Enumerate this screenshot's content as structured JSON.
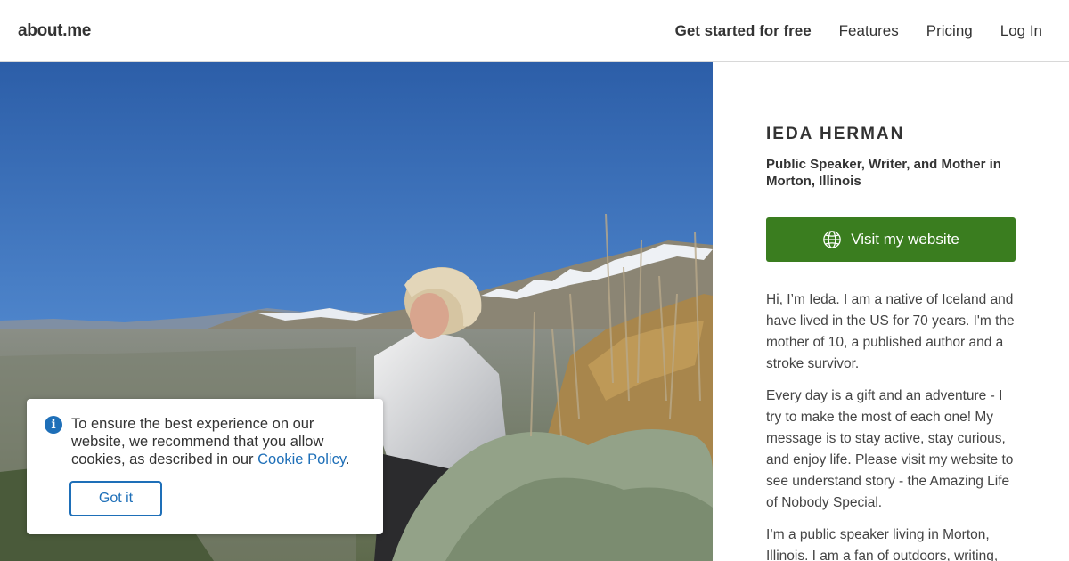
{
  "header": {
    "logo": "about.me",
    "nav": {
      "get_started": "Get started for free",
      "features": "Features",
      "pricing": "Pricing",
      "login": "Log In"
    }
  },
  "cookie": {
    "text_before": "To ensure the best experience on our website, we recommend that you allow cookies, as described in our ",
    "link": "Cookie Policy",
    "text_after": ".",
    "button": "Got it"
  },
  "profile": {
    "name": "IEDA HERMAN",
    "headline": "Public Speaker, Writer, and Mother in Morton, Illinois",
    "visit_button": "Visit my website",
    "bio": [
      "Hi, I’m Ieda. I am a native of Iceland and have lived in the US for 70 years. I'm the mother of 10, a published author and a stroke survivor.",
      "Every day is a gift and an adventure - I try to make the most of each one! My message is to stay active, stay curious, and enjoy life. Please visit my website to see understand story - the Amazing Life of Nobody Special.",
      "I’m a public speaker living in Morton, Illinois. I am a fan of outdoors, writing,"
    ]
  },
  "colors": {
    "accent_green": "#3a7d1f",
    "link_blue": "#1e6fb8"
  },
  "icons": {
    "info": "info-circle-icon",
    "globe": "globe-icon"
  }
}
